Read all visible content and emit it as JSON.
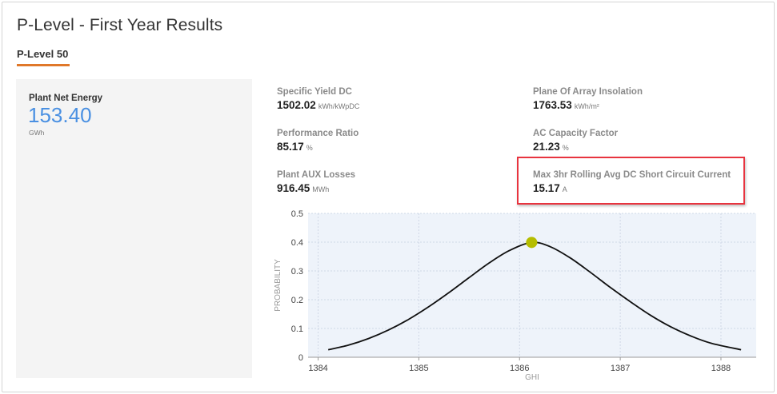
{
  "page": {
    "title": "P-Level - First Year Results",
    "tab_label": "P-Level 50"
  },
  "summary": {
    "label": "Plant Net Energy",
    "value": "153.40",
    "unit": "GWh"
  },
  "metrics": [
    {
      "label": "Specific Yield DC",
      "value": "1502.02",
      "unit": "kWh/kWpDC"
    },
    {
      "label": "Plane Of Array Insolation",
      "value": "1763.53",
      "unit": "kWh/m²"
    },
    {
      "label": "Performance Ratio",
      "value": "85.17",
      "unit": "%"
    },
    {
      "label": "AC Capacity Factor",
      "value": "21.23",
      "unit": "%"
    },
    {
      "label": "Plant AUX Losses",
      "value": "916.45",
      "unit": "MWh"
    },
    {
      "label": "Max 3hr Rolling Avg DC Short Circuit Current",
      "value": "15.17",
      "unit": "A"
    }
  ],
  "colors": {
    "accent_tab": "#e0782a",
    "value_blue": "#4a90e2",
    "highlight_red": "#e8343f",
    "plot_bg": "#eef3fa",
    "marker": "#b5bd00"
  },
  "chart_data": {
    "type": "line",
    "xlabel": "GHI",
    "ylabel": "PROBABILITY",
    "xlim": [
      1383.9,
      1388.35
    ],
    "ylim": [
      0,
      0.5
    ],
    "x_ticks": [
      1384,
      1385,
      1386,
      1387,
      1388
    ],
    "y_ticks": [
      0,
      0.1,
      0.2,
      0.3,
      0.4,
      0.5
    ],
    "x_tick_labels": [
      "1384",
      "1385",
      "1386",
      "1387",
      "1388"
    ],
    "y_tick_labels": [
      "0",
      "0.1",
      "0.2",
      "0.3",
      "0.4",
      "0.5"
    ],
    "grid": true,
    "series": [
      {
        "x": [
          1384.1,
          1384.3,
          1384.5,
          1384.7,
          1384.9,
          1385.1,
          1385.3,
          1385.5,
          1385.7,
          1385.9,
          1386.12,
          1386.3,
          1386.5,
          1386.7,
          1386.9,
          1387.1,
          1387.3,
          1387.5,
          1387.7,
          1387.9,
          1388.2
        ],
        "y": [
          0.026,
          0.042,
          0.065,
          0.095,
          0.132,
          0.176,
          0.225,
          0.277,
          0.328,
          0.371,
          0.399,
          0.385,
          0.346,
          0.296,
          0.243,
          0.193,
          0.146,
          0.106,
          0.074,
          0.049,
          0.026
        ]
      }
    ],
    "marker": {
      "x": 1386.12,
      "y": 0.399
    }
  }
}
